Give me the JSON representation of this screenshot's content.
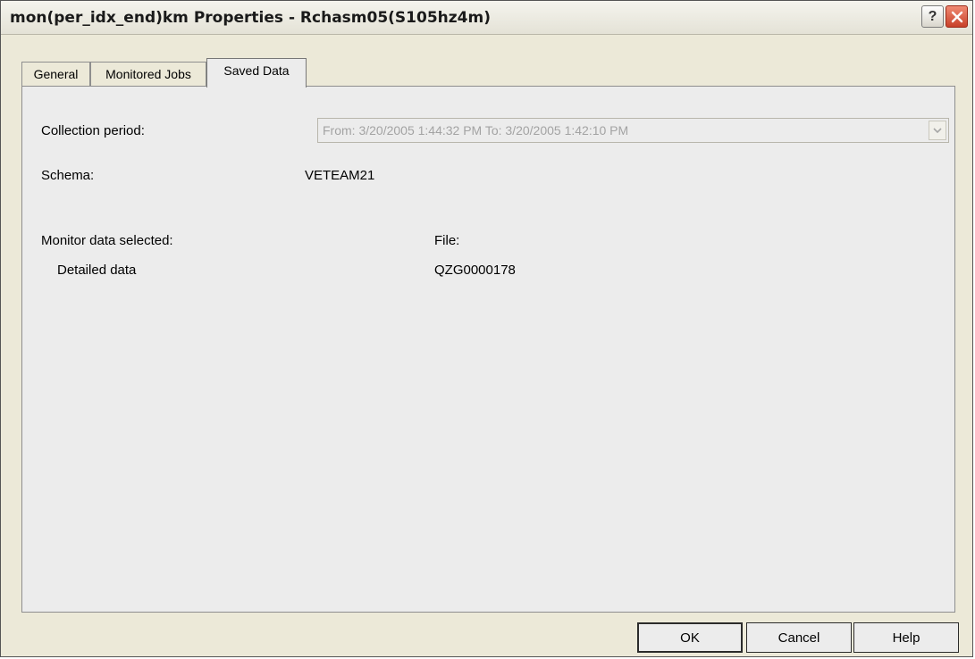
{
  "window": {
    "title": "mon(per_idx_end)km Properties - Rchasm05(S105hz4m)",
    "help_button": "?",
    "close_icon": "close-icon"
  },
  "tabs": [
    {
      "label": "General",
      "active": false
    },
    {
      "label": "Monitored Jobs",
      "active": false
    },
    {
      "label": "Saved Data",
      "active": true
    }
  ],
  "saved_data": {
    "collection_period_label": "Collection period:",
    "collection_period_value": "From:  3/20/2005  1:44:32 PM   To:  3/20/2005  1:42:10 PM",
    "schema_label": "Schema:",
    "schema_value": "VETEAM21",
    "monitor_data_label": "Monitor data selected:",
    "file_label": "File:",
    "detailed_data_label": "Detailed data",
    "detailed_data_file": "QZG0000178"
  },
  "buttons": {
    "ok": "OK",
    "cancel": "Cancel",
    "help": "Help"
  },
  "colors": {
    "dialog_background": "#ece9d8",
    "panel_background": "#ececec",
    "close_button": "#c8412a",
    "disabled_text": "#a3a3a3"
  }
}
